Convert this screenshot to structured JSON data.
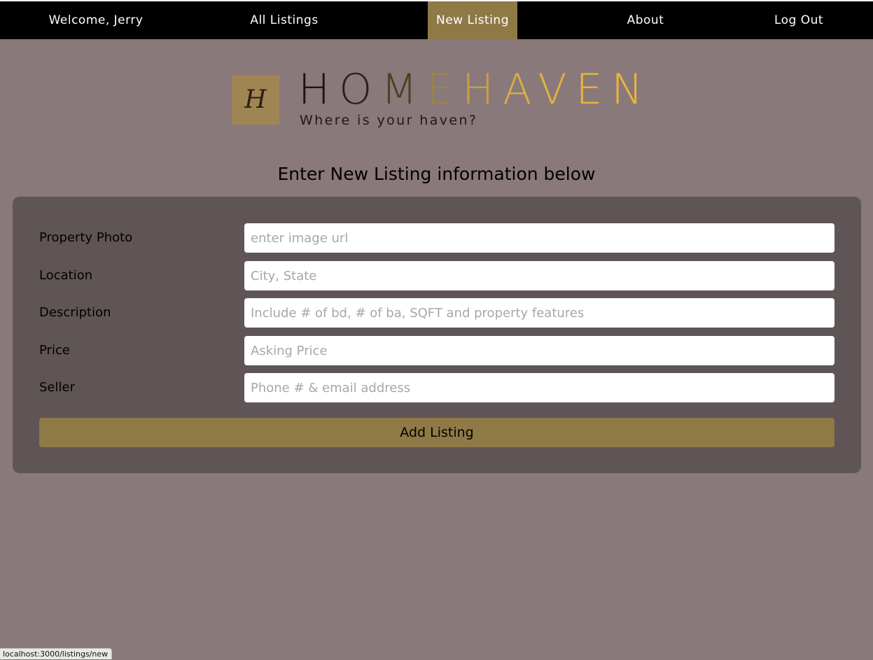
{
  "nav": {
    "items": [
      {
        "label": "Welcome, Jerry"
      },
      {
        "label": "All Listings"
      },
      {
        "label": "New Listing",
        "active": true
      },
      {
        "label": "About"
      },
      {
        "label": "Log Out"
      }
    ]
  },
  "logo": {
    "badge_letter": "H",
    "brand_letters": [
      "H",
      "O",
      "M",
      "E",
      "H",
      "A",
      "V",
      "E",
      "N"
    ],
    "tagline": "Where is your haven?"
  },
  "heading": "Enter New Listing information below",
  "form": {
    "fields": [
      {
        "label": "Property Photo",
        "placeholder": "enter image url",
        "value": ""
      },
      {
        "label": "Location",
        "placeholder": "City, State",
        "value": ""
      },
      {
        "label": "Description",
        "placeholder": "Include # of bd, # of ba, SQFT and property features",
        "value": ""
      },
      {
        "label": "Price",
        "placeholder": "Asking Price",
        "value": ""
      },
      {
        "label": "Seller",
        "placeholder": "Phone # & email address",
        "value": ""
      }
    ],
    "submit_label": "Add Listing"
  },
  "status_bar": {
    "url": "localhost:3000/listings/new"
  },
  "colors": {
    "background": "#8a797a",
    "navbar": "#000000",
    "accent_gold": "#8f7a47",
    "form_card": "#605556",
    "input_bg": "#ffffff"
  }
}
